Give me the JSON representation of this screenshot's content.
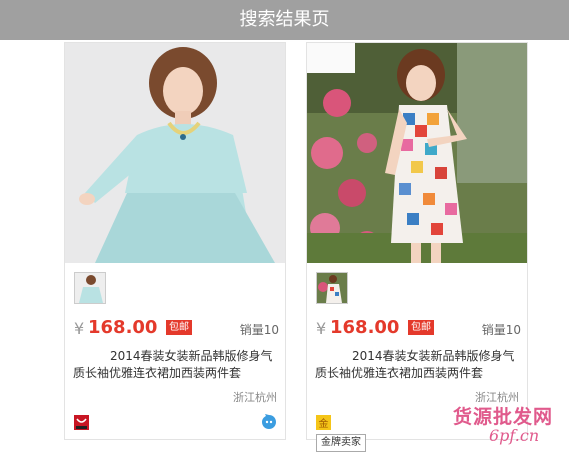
{
  "header": {
    "title": "搜索结果页"
  },
  "products": [
    {
      "yen": "¥",
      "price": "168.00",
      "badge": "包邮",
      "sales": "销量10",
      "title": "2014春装女装新品韩版修身气质长袖优雅连衣裙加西装两件套",
      "location": "浙江杭州",
      "image_desc": "model in light blue dress",
      "shop_icon": "red-shop-icon",
      "right_icon": "chat-icon"
    },
    {
      "yen": "¥",
      "price": "168.00",
      "badge": "包邮",
      "sales": "销量10",
      "title": "2014春装女装新品韩版修身气质长袖优雅连衣裙加西装两件套",
      "location": "浙江杭州",
      "image_desc": "model in colorful patchwork dress",
      "shop_icon": "gold-medal-icon",
      "right_icon": "chat-icon"
    }
  ],
  "tooltip": {
    "text": "金牌卖家"
  },
  "watermark": {
    "cn": "货源批发网",
    "url": "6pf.cn"
  }
}
